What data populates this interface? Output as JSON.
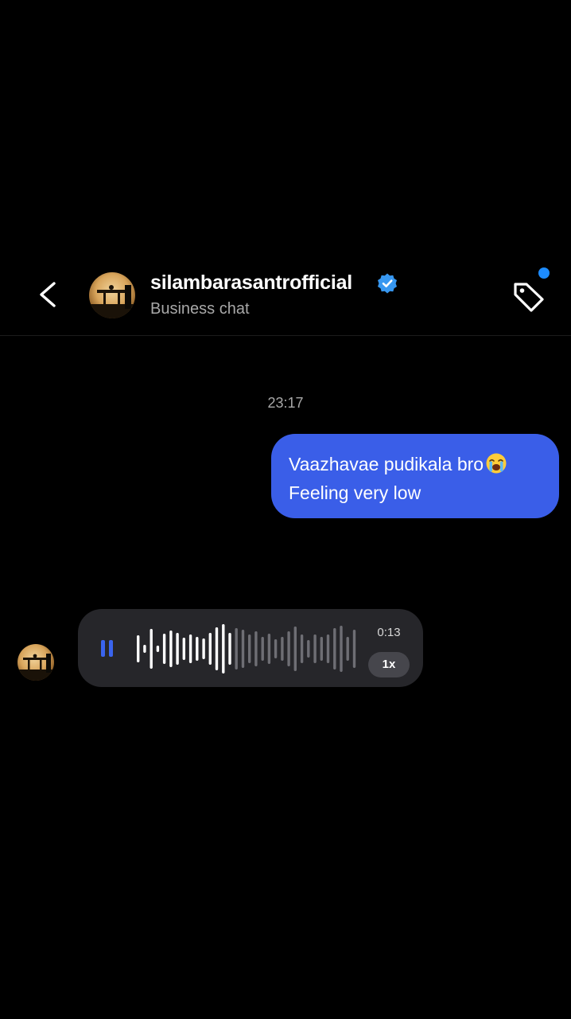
{
  "header": {
    "username": "silambarasantrofficial",
    "subtitle": "Business chat",
    "verified": true,
    "accent_color": "#1d8cff",
    "icons": [
      "chevron-left-icon",
      "verified-badge-icon",
      "tag-icon"
    ]
  },
  "conversation": {
    "timestamp": "23:17",
    "messages": [
      {
        "direction": "outgoing",
        "type": "text",
        "lines": [
          "Vaazhavae pudikala bro",
          "Feeling very low"
        ],
        "emoji": "loudly-crying-face-icon",
        "bubble_color": "#3a5ee8"
      },
      {
        "direction": "incoming",
        "type": "voice",
        "duration": "0:13",
        "speed": "1x",
        "state": "playing",
        "progress": 0.42,
        "play_color": "#3a64ee"
      }
    ]
  }
}
